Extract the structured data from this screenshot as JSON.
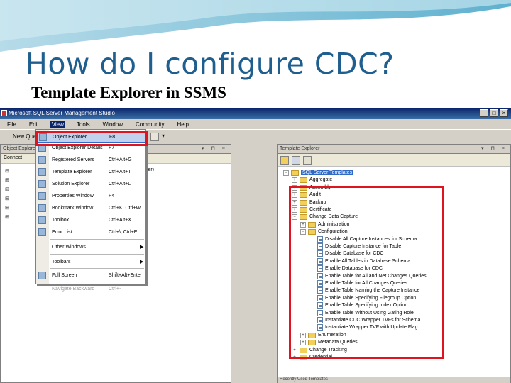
{
  "slide": {
    "title": "How do I configure CDC?",
    "subtitle": "Template Explorer in SSMS"
  },
  "app": {
    "window_title": "Microsoft SQL Server Management Studio"
  },
  "menubar": [
    {
      "label": "File"
    },
    {
      "label": "Edit"
    },
    {
      "label": "View",
      "active": true
    },
    {
      "label": "Tools"
    },
    {
      "label": "Window"
    },
    {
      "label": "Community"
    },
    {
      "label": "Help"
    }
  ],
  "toolbar": {
    "new_query_label": "New Query"
  },
  "object_explorer": {
    "header": "Object Explorer",
    "connect_label": "Connect",
    "server_suffix": "ster)"
  },
  "view_menu": {
    "items": [
      {
        "label": "Object Explorer",
        "shortcut": "F8",
        "highlighted": true
      },
      {
        "label": "Object Explorer Details",
        "shortcut": "F7"
      },
      {
        "label": "Registered Servers",
        "shortcut": "Ctrl+Alt+G"
      },
      {
        "label": "Template Explorer",
        "shortcut": "Ctrl+Alt+T"
      },
      {
        "label": "Solution Explorer",
        "shortcut": "Ctrl+Alt+L"
      },
      {
        "label": "Properties Window",
        "shortcut": "F4"
      },
      {
        "label": "Bookmark Window",
        "shortcut": "Ctrl+K, Ctrl+W"
      },
      {
        "label": "Toolbox",
        "shortcut": "Ctrl+Alt+X"
      },
      {
        "label": "Error List",
        "shortcut": "Ctrl+\\, Ctrl+E"
      },
      {
        "label": "Other Windows",
        "shortcut": "",
        "submenu": true
      },
      {
        "label": "Toolbars",
        "shortcut": "",
        "submenu": true
      },
      {
        "label": "Full Screen",
        "shortcut": "Shift+Alt+Enter"
      },
      {
        "label": "Navigate Backward",
        "shortcut": "Ctrl+-",
        "disabled": true
      }
    ]
  },
  "template_explorer": {
    "header": "Template Explorer",
    "root": "SQL Server Templates",
    "folders_top": [
      "Aggregate",
      "Assembly",
      "Audit",
      "Backup",
      "Certificate"
    ],
    "cdc_folder": "Change Data Capture",
    "cdc_children": [
      "Administration",
      "Configuration"
    ],
    "config_templates": [
      "Disable All Capture Instances for Schema",
      "Disable Capture Instance for Table",
      "Disable Database for CDC",
      "Enable All Tables in Database Schema",
      "Enable Database for CDC",
      "Enable Table for All and Net Changes Queries",
      "Enable Table for All Changes Queries",
      "Enable Table Naming the Capture Instance",
      "Enable Table Specifying Filegroup Option",
      "Enable Table Specifying Index Option",
      "Enable Table Without Using Gating Role",
      "Instantiate CDC Wrapper TVFs for Schema",
      "Instantiate Wrapper TVF with Update Flag"
    ],
    "cdc_after": [
      "Enumeration",
      "Metadata Queries"
    ],
    "folders_bottom": [
      "Change Tracking",
      "Credential"
    ],
    "recent_label": "Recently Used Templates"
  }
}
